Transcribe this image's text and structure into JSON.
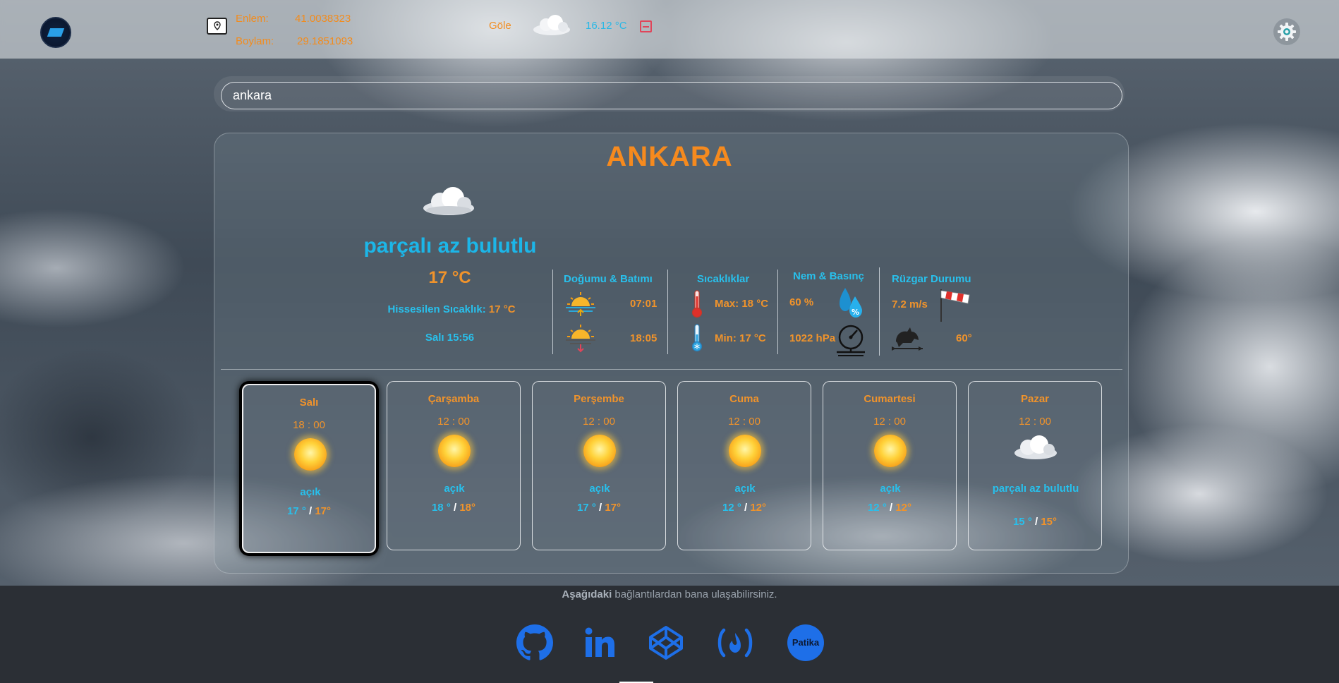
{
  "colors": {
    "accent_orange": "#f68a1e",
    "accent_blue": "#28c0ec",
    "footer_bg": "#2b2f35",
    "social_blue": "#1e6fe8",
    "close_red": "#e0455a"
  },
  "header": {
    "logo_icon": "app-logo",
    "location_icon": "map-pin-icon",
    "latitude_label": "Enlem:",
    "latitude_value": "41.0038323",
    "longitude_label": "Boylam:",
    "longitude_value": "29.1851093",
    "mini_city": "Göle",
    "mini_weather_icon": "cloud-icon",
    "mini_temp": "16.12 °C",
    "close_icon": "minus-square-icon",
    "settings_icon": "gear-icon"
  },
  "search": {
    "value": "ankara",
    "placeholder": ""
  },
  "current": {
    "city": "ANKARA",
    "weather_icon": "partly-cloudy-icon",
    "description": "parçalı az bulutlu",
    "temp": "17 °C",
    "feels_label": "Hissesilen Sıcaklık:",
    "feels_value": "17 °C",
    "day_time": "Salı  15:56",
    "sun": {
      "title": "Doğumu & Batımı",
      "sunrise": "07:01",
      "sunset": "18:05"
    },
    "temps": {
      "title": "Sıcaklıklar",
      "max": "Max: 18 °C",
      "min": "Min: 17 °C"
    },
    "humidity": {
      "title": "Nem & Basınç",
      "humidity": "60 %",
      "pressure": "1022 hPa"
    },
    "wind": {
      "title": "Rüzgar Durumu",
      "speed": "7.2 m/s",
      "direction": "60°"
    }
  },
  "forecast": [
    {
      "day": "Salı",
      "time": "18 : 00",
      "icon": "sun-icon",
      "desc": "açık",
      "min": "17 °",
      "max": "17°",
      "active": true
    },
    {
      "day": "Çarşamba",
      "time": "12 : 00",
      "icon": "sun-icon",
      "desc": "açık",
      "min": "18 °",
      "max": "18°"
    },
    {
      "day": "Perşembe",
      "time": "12 : 00",
      "icon": "sun-icon",
      "desc": "açık",
      "min": "17 °",
      "max": "17°"
    },
    {
      "day": "Cuma",
      "time": "12 : 00",
      "icon": "sun-icon",
      "desc": "açık",
      "min": "12 °",
      "max": "12°"
    },
    {
      "day": "Cumartesi",
      "time": "12 : 00",
      "icon": "sun-icon",
      "desc": "açık",
      "min": "12 °",
      "max": "12°"
    },
    {
      "day": "Pazar",
      "time": "12 : 00",
      "icon": "partly-cloudy-icon",
      "desc": "parçalı az bulutlu",
      "min": "15 °",
      "max": "15°"
    }
  ],
  "footer": {
    "text_bold": "Aşağıdaki",
    "text_rest": " bağlantılardan bana ulaşabilirsiniz.",
    "links": [
      {
        "icon": "github-icon"
      },
      {
        "icon": "linkedin-icon"
      },
      {
        "icon": "codepen-icon"
      },
      {
        "icon": "freecodecamp-icon"
      },
      {
        "icon": "patika-icon",
        "label": "Patika"
      }
    ]
  }
}
